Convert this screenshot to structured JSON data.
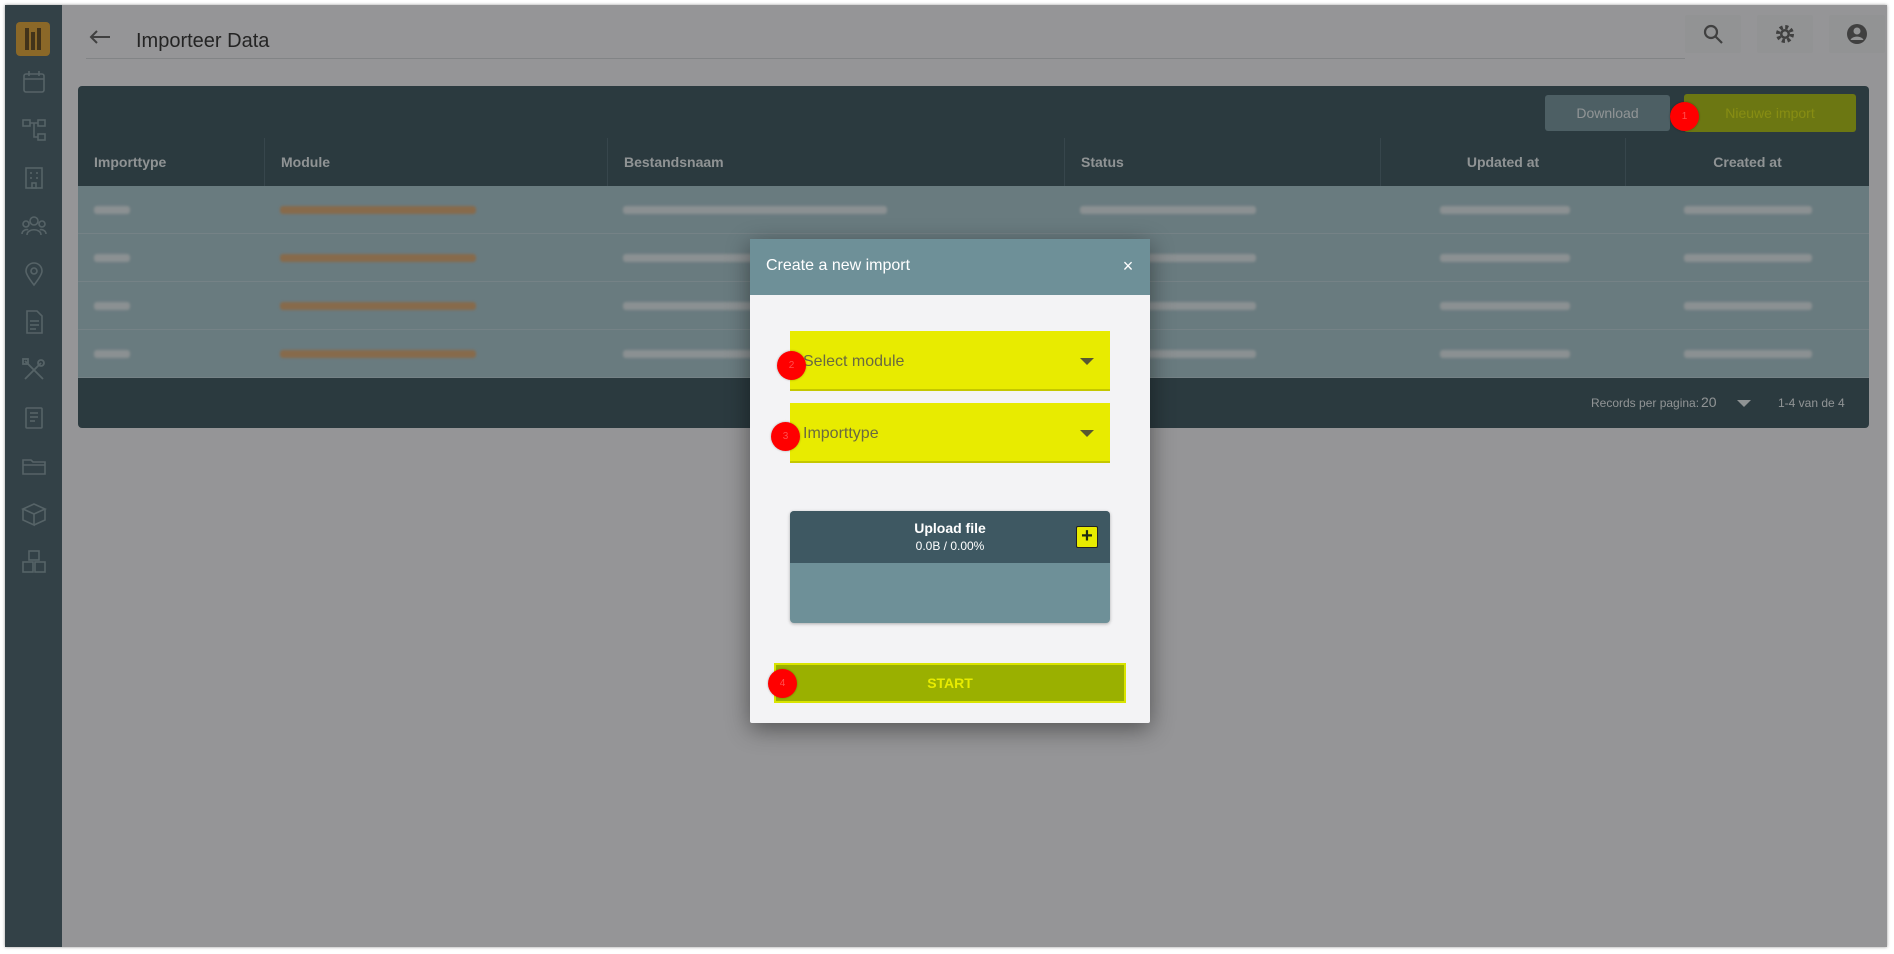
{
  "header": {
    "title": "Importeer Data",
    "back_icon": "arrow-left-icon",
    "actions": [
      "search-icon",
      "gear-icon",
      "account-circle-icon"
    ]
  },
  "sidebar": {
    "logo": "app-logo",
    "icons": [
      "calendar-icon",
      "workflow-icon",
      "building-icon",
      "people-icon",
      "location-icon",
      "document-icon",
      "tools-icon",
      "report-icon",
      "folder-icon",
      "box-icon",
      "stacked-boxes-icon"
    ]
  },
  "toolbar": {
    "download_label": "Download",
    "new_import_label": "Nieuwe import"
  },
  "table": {
    "columns": [
      "Importtype",
      "Module",
      "Bestandsnaam",
      "Status",
      "Updated at",
      "Created at"
    ],
    "row_count": 4
  },
  "pagination": {
    "records_per_page_label": "Records per pagina:",
    "records_per_page": "20",
    "range": "1-4 van de 4"
  },
  "modal": {
    "title": "Create a new import",
    "close_label": "×",
    "module_placeholder": "Select module",
    "importtype_placeholder": "Importtype",
    "upload_title": "Upload file",
    "upload_progress": "0.0B / 0.00%",
    "upload_add": "+",
    "start_label": "START"
  },
  "colors": {
    "sidebar": "#3e5862",
    "accent_yellow": "#e8eb00",
    "accent_green": "#9ab000",
    "marker": "#ff0000"
  }
}
